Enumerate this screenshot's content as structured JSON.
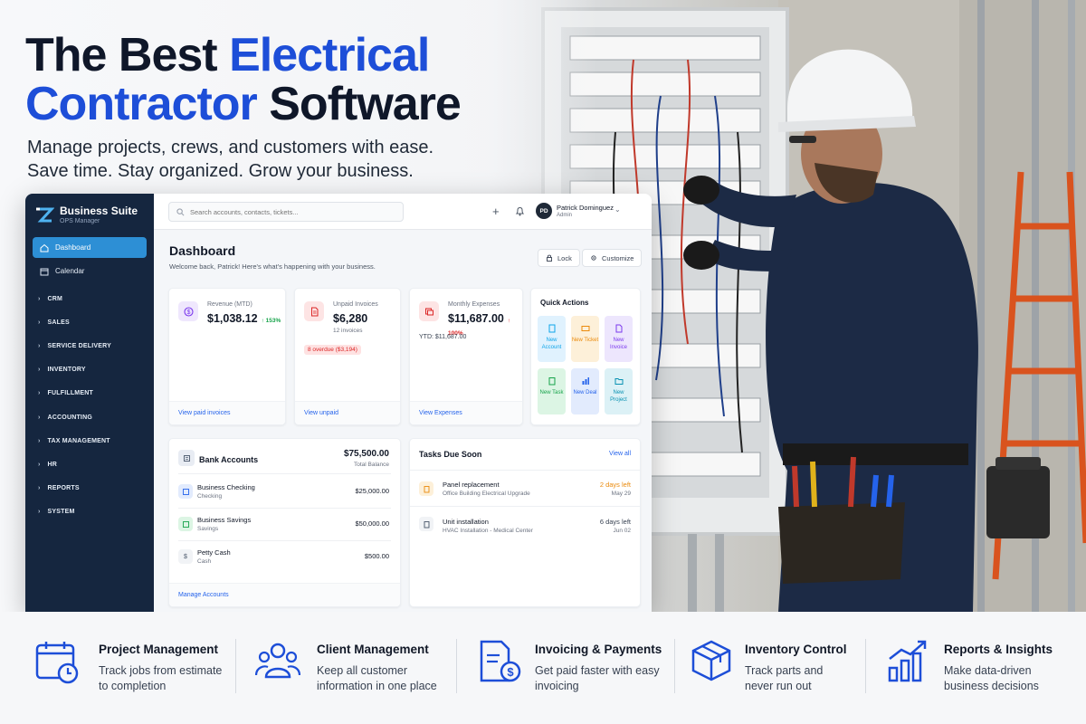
{
  "headline": {
    "line1_dark": "The Best ",
    "line1_blue": "Electrical",
    "line2_blue": "Contractor",
    "line2_dark": " Software"
  },
  "subheadline": {
    "line1": "Manage projects, crews, and customers with ease.",
    "line2": "Save time. Stay organized. Grow your business."
  },
  "app": {
    "brand": {
      "name": "Business Suite",
      "sub": "OPS Manager"
    },
    "sidebar": {
      "main_items": [
        {
          "label": "Dashboard",
          "icon": "home-icon",
          "active": true
        },
        {
          "label": "Calendar",
          "icon": "calendar-icon",
          "active": false
        }
      ],
      "sections": [
        "CRM",
        "SALES",
        "SERVICE DELIVERY",
        "INVENTORY",
        "FULFILLMENT",
        "ACCOUNTING",
        "TAX MANAGEMENT",
        "HR",
        "REPORTS",
        "SYSTEM"
      ]
    },
    "topbar": {
      "search_placeholder": "Search accounts, contacts, tickets...",
      "user": {
        "initials": "PD",
        "name": "Patrick Dominguez",
        "role": "Admin"
      }
    },
    "dashboard": {
      "title": "Dashboard",
      "welcome": "Welcome back, Patrick! Here's what's happening with your business.",
      "lock_label": "Lock",
      "customize_label": "Customize",
      "stats": {
        "revenue": {
          "label": "Revenue (MTD)",
          "value": "$1,038.12",
          "delta": "↑ 153%",
          "link": "View paid invoices"
        },
        "unpaid": {
          "label": "Unpaid Invoices",
          "value": "$6,280",
          "sub": "12 invoices",
          "overdue": "8 overdue ($3,194)",
          "link": "View unpaid"
        },
        "expenses": {
          "label": "Monthly Expenses",
          "value": "$11,687.00",
          "delta": "↑ 100%",
          "ytd": "YTD: $11,687.00",
          "link": "View Expenses"
        }
      },
      "quick_actions": {
        "title": "Quick Actions",
        "items": [
          {
            "label": "New Account",
            "color": "#0ea5e9",
            "bg": "#e0f2fe"
          },
          {
            "label": "New Ticket",
            "color": "#ea8a0c",
            "bg": "#fdf0d9"
          },
          {
            "label": "New Invoice",
            "color": "#7c3aed",
            "bg": "#ede6fd"
          },
          {
            "label": "New Task",
            "color": "#16a34a",
            "bg": "#dcf5e4"
          },
          {
            "label": "New Deal",
            "color": "#2563eb",
            "bg": "#e2ebfd"
          },
          {
            "label": "New Project",
            "color": "#0891b2",
            "bg": "#dcf1f6"
          }
        ]
      },
      "bank_accounts": {
        "title": "Bank Accounts",
        "total": "$75,500.00",
        "total_label": "Total Balance",
        "rows": [
          {
            "name": "Business Checking",
            "type": "Checking",
            "amount": "$25,000.00"
          },
          {
            "name": "Business Savings",
            "type": "Savings",
            "amount": "$50,000.00"
          },
          {
            "name": "Petty Cash",
            "type": "Cash",
            "amount": "$500.00"
          }
        ],
        "link": "Manage Accounts"
      },
      "tasks": {
        "title": "Tasks Due Soon",
        "view_all": "View all",
        "rows": [
          {
            "name": "Panel replacement",
            "project": "Office Building Electrical Upgrade",
            "due": "2 days left",
            "date": "May 29"
          },
          {
            "name": "Unit installation",
            "project": "HVAC Installation - Medical Center",
            "due": "6 days left",
            "date": "Jun 02"
          }
        ]
      }
    }
  },
  "features": [
    {
      "icon": "calendar-clock-icon",
      "title": "Project Management",
      "desc": "Track jobs from estimate to completion"
    },
    {
      "icon": "people-icon",
      "title": "Client Management",
      "desc": "Keep all customer information in one place"
    },
    {
      "icon": "invoice-dollar-icon",
      "title": "Invoicing & Payments",
      "desc": "Get paid faster with easy invoicing"
    },
    {
      "icon": "box-icon",
      "title": "Inventory Control",
      "desc": "Track parts and never run out"
    },
    {
      "icon": "bar-chart-icon",
      "title": "Reports & Insights",
      "desc": "Make data-driven business decisions"
    }
  ],
  "colors": {
    "accent_blue": "#1d4ed8",
    "sidebar": "#15263f",
    "active_nav": "#2d8fd5"
  }
}
